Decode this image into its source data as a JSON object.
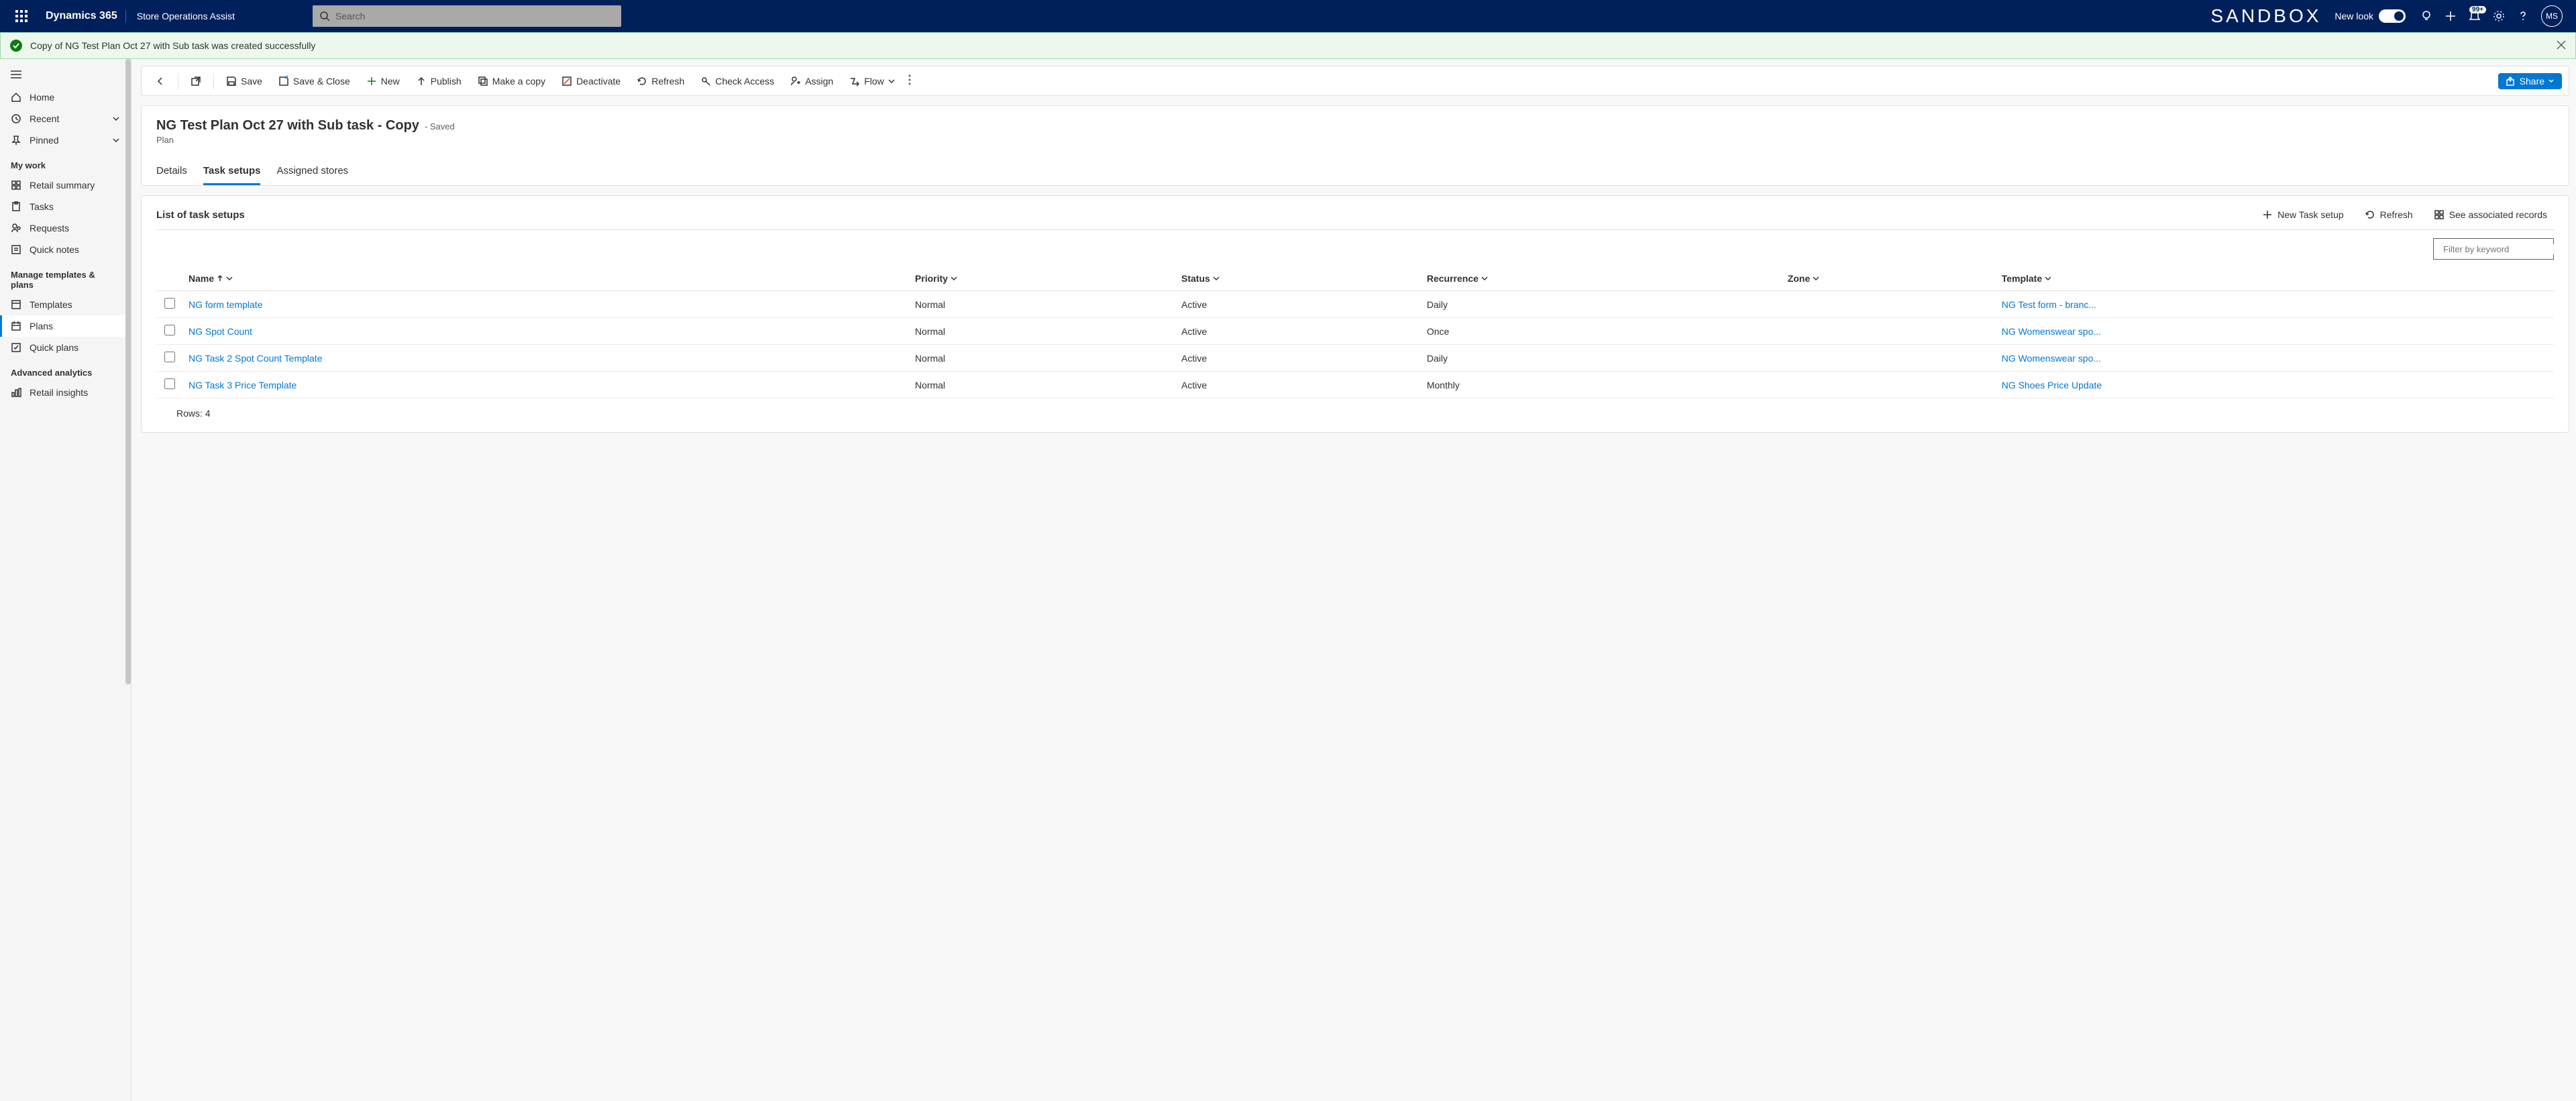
{
  "header": {
    "brand": "Dynamics 365",
    "app": "Store Operations Assist",
    "search_placeholder": "Search",
    "sandbox": "SANDBOX",
    "newlook": "New look",
    "badge": "99+",
    "avatar": "MS"
  },
  "notification": {
    "message": "Copy of NG Test Plan Oct 27 with Sub task was created successfully"
  },
  "nav": {
    "home": "Home",
    "recent": "Recent",
    "pinned": "Pinned",
    "group_mywork": "My work",
    "retail_summary": "Retail summary",
    "tasks": "Tasks",
    "requests": "Requests",
    "quick_notes": "Quick notes",
    "group_templates": "Manage templates & plans",
    "templates": "Templates",
    "plans": "Plans",
    "quick_plans": "Quick plans",
    "group_analytics": "Advanced analytics",
    "retail_insights": "Retail insights"
  },
  "commands": {
    "save": "Save",
    "save_close": "Save & Close",
    "new": "New",
    "publish": "Publish",
    "make_copy": "Make a copy",
    "deactivate": "Deactivate",
    "refresh": "Refresh",
    "check_access": "Check Access",
    "assign": "Assign",
    "flow": "Flow",
    "share": "Share"
  },
  "record": {
    "title": "NG Test Plan Oct 27 with Sub task - Copy",
    "saved_suffix": "- Saved",
    "type": "Plan",
    "tabs": {
      "details": "Details",
      "task_setups": "Task setups",
      "assigned_stores": "Assigned stores"
    }
  },
  "subgrid": {
    "title": "List of task setups",
    "new_task": "New Task setup",
    "refresh": "Refresh",
    "see_records": "See associated records",
    "filter_placeholder": "Filter by keyword",
    "columns": {
      "name": "Name",
      "priority": "Priority",
      "status": "Status",
      "recurrence": "Recurrence",
      "zone": "Zone",
      "template": "Template"
    },
    "rows": [
      {
        "name": "NG form template",
        "priority": "Normal",
        "status": "Active",
        "recurrence": "Daily",
        "zone": "",
        "template": "NG Test form - branc..."
      },
      {
        "name": "NG Spot Count",
        "priority": "Normal",
        "status": "Active",
        "recurrence": "Once",
        "zone": "",
        "template": "NG Womenswear spo..."
      },
      {
        "name": "NG Task 2 Spot Count Template",
        "priority": "Normal",
        "status": "Active",
        "recurrence": "Daily",
        "zone": "",
        "template": "NG Womenswear spo..."
      },
      {
        "name": "NG Task 3 Price Template",
        "priority": "Normal",
        "status": "Active",
        "recurrence": "Monthly",
        "zone": "",
        "template": "NG Shoes Price Update"
      }
    ],
    "rowcount": "Rows: 4"
  }
}
